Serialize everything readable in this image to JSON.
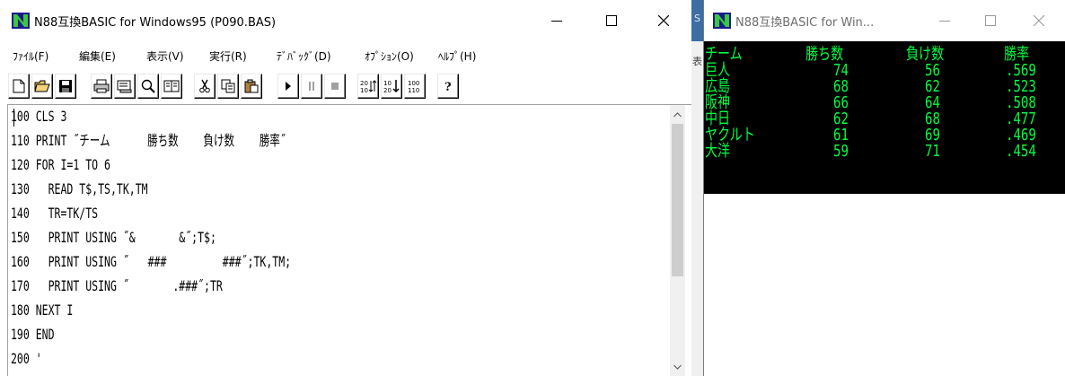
{
  "editor_window": {
    "title": "N88互換BASIC for Windows95 (P090.BAS)",
    "menu": [
      "ﾌｧｲﾙ(F)",
      "編集(E)",
      "表示(V)",
      "実行(R)",
      "ﾃﾞﾊﾞｯｸﾞ(D)",
      "ｵﾌﾟｼｮﾝ(O)",
      "ﾍﾙﾌﾟ(H)"
    ],
    "toolbar_icons": [
      "new-icon",
      "open-icon",
      "save-icon",
      "print-icon",
      "print-preview-icon",
      "find-icon",
      "book-icon",
      "cut-icon",
      "copy-icon",
      "paste-icon",
      "run-icon",
      "pause-icon",
      "stop-icon",
      "renumber-icon",
      "sort-icon",
      "line-number-icon",
      "help-icon"
    ],
    "code_lines": [
      "100 CLS 3",
      "110 PRINT ˝チーム      勝ち数    負け数    勝率˝",
      "120 FOR I=1 TO 6",
      "130   READ T$,TS,TK,TM",
      "140   TR=TK/TS",
      "150   PRINT USING ˝&       &˝;T$;",
      "160   PRINT USING ˝   ###         ###˝;TK,TM;",
      "170   PRINT USING ˝       .###˝;TR",
      "180 NEXT I",
      "190 END",
      "200 '"
    ]
  },
  "output_window": {
    "title": "N88互換BASIC for Win...",
    "header": [
      "チーム",
      "勝ち数",
      "負け数",
      "勝率"
    ],
    "rows": [
      [
        "巨人",
        "74",
        "56",
        ".569"
      ],
      [
        "広島",
        "68",
        "62",
        ".523"
      ],
      [
        "阪神",
        "66",
        "64",
        ".508"
      ],
      [
        "中日",
        "62",
        "68",
        ".477"
      ],
      [
        "ヤクルト",
        "61",
        "69",
        ".469"
      ],
      [
        "大洋",
        "59",
        "71",
        ".454"
      ]
    ],
    "text_color": "#00ff40",
    "background_color": "#000000"
  },
  "background_fragments": [
    "S",
    "表"
  ]
}
